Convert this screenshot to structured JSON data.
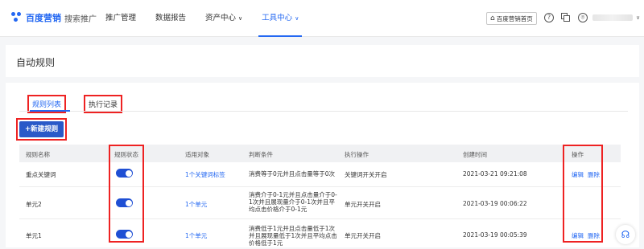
{
  "header": {
    "brand": "百度营销",
    "brand_sub": "搜索推广",
    "nav": [
      {
        "label": "推广管理",
        "caret": false
      },
      {
        "label": "数据报告",
        "caret": false
      },
      {
        "label": "资产中心",
        "caret": true
      },
      {
        "label": "工具中心",
        "caret": true,
        "active": true
      }
    ],
    "home_button": "百度营销首页",
    "help_icon_glyph": "?",
    "user_caret": "∨"
  },
  "page": {
    "title": "自动规则"
  },
  "tabs": [
    {
      "label": "规则列表",
      "active": true
    },
    {
      "label": "执行记录",
      "active": false
    }
  ],
  "add_button": "+新建规则",
  "table": {
    "columns": [
      "规则名称",
      "规则状态",
      "适用对象",
      "判断条件",
      "执行操作",
      "创建时间",
      "操作"
    ],
    "rows": [
      {
        "name": "重点关键词",
        "status_on": true,
        "target": "1个关键词标签",
        "condition": "消费等于0元并且点击量等于0次",
        "action": "关键词开关开启",
        "created": "2021-03-21 09:21:08",
        "ops": [
          "编辑",
          "删除"
        ]
      },
      {
        "name": "单元2",
        "status_on": true,
        "target": "1个单元",
        "condition": "消费介于0-1元并且点击量介于0-1次并且展现量介于0-1次并且平均点击价格介于0-1元",
        "action": "单元开关开启",
        "created": "2021-03-19 00:06:22",
        "ops": [
          "编辑",
          "删除"
        ]
      },
      {
        "name": "单元1",
        "status_on": true,
        "target": "1个单元",
        "condition": "消费低于1元并且点击量低于1次并且展现量低于1次并且平均点击价格低于1元",
        "action": "单元开关开启",
        "created": "2021-03-19 00:05:39",
        "ops": [
          "编辑",
          "删除"
        ]
      }
    ]
  },
  "colors": {
    "accent": "#2468f2",
    "toggle_on": "#1f4fd4",
    "highlight": "#e22222"
  }
}
